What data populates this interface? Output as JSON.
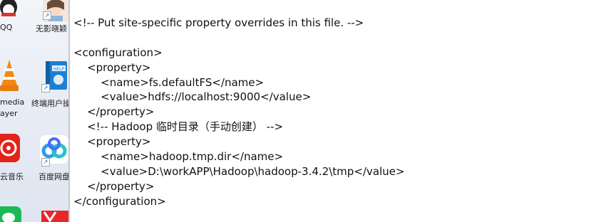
{
  "desktop": {
    "icons": [
      {
        "label": "QQ",
        "icon": "qq-icon"
      },
      {
        "label": "无影晓颖",
        "icon": "avatar-shortcut-icon"
      },
      {
        "label": "media",
        "label2": "ayer",
        "icon": "vlc-media-player-icon"
      },
      {
        "label": "终端用户操",
        "icon": "help-book-icon"
      },
      {
        "label": "云音乐",
        "icon": "netease-music-icon"
      },
      {
        "label": "百度网盘",
        "icon": "baidu-netdisk-icon"
      }
    ]
  },
  "editor": {
    "lines": [
      "<!-- Put site-specific property overrides in this file. -->",
      "",
      "<configuration>",
      "    <property>",
      "        <name>fs.defaultFS</name>",
      "        <value>hdfs://localhost:9000</value>",
      "    </property>",
      "    <!-- Hadoop 临时目录（手动创建） -->",
      "    <property>",
      "        <name>hadoop.tmp.dir</name>",
      "        <value>D:\\workAPP\\Hadoop\\hadoop-3.4.2\\tmp</value>",
      "    </property>",
      "</configuration>"
    ]
  }
}
